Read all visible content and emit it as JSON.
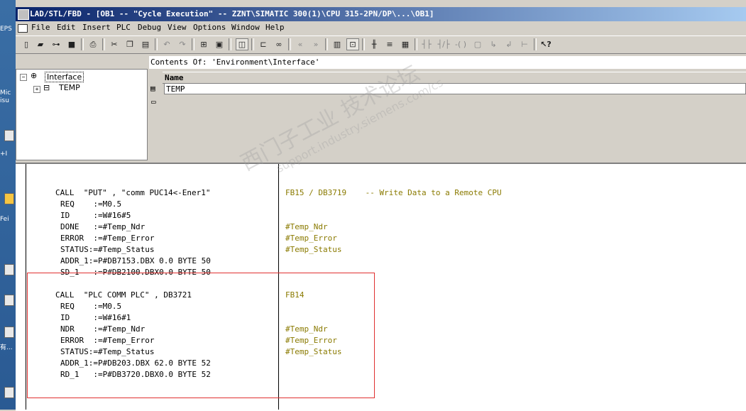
{
  "window": {
    "title": "LAD/STL/FBD  - [OB1 -- \"Cycle Execution\" -- ZZNT\\SIMATIC 300(1)\\CPU 315-2PN/DP\\...\\OB1]"
  },
  "desktop": {
    "labels": [
      "EPS",
      "Mic",
      "isu",
      "+I",
      "Fei",
      "有..."
    ]
  },
  "menu": {
    "items": [
      "File",
      "Edit",
      "Insert",
      "PLC",
      "Debug",
      "View",
      "Options",
      "Window",
      "Help"
    ]
  },
  "toolbar": {
    "icons": [
      "new-icon",
      "open-icon",
      "network-icon",
      "save-icon",
      "print-icon",
      "cut-icon",
      "copy-icon",
      "paste-icon",
      "undo-icon",
      "redo-icon",
      "monitor-icon",
      "download-icon",
      "overview-icon",
      "network-view-icon",
      "glasses-icon",
      "back-icon",
      "forward-icon",
      "panel-icon",
      "zoom-icon",
      "ladder-icon",
      "stl-icon",
      "fbd-icon",
      "contact-no-icon",
      "contact-nc-icon",
      "coil-icon",
      "box-icon",
      "branch-open-icon",
      "branch-close-icon",
      "jump-icon",
      "help-icon"
    ]
  },
  "interface_tree": {
    "root": "Interface",
    "child": "TEMP"
  },
  "contents": {
    "header": "Contents Of: 'Environment\\Interface'",
    "column_name": "Name",
    "rows": [
      "TEMP"
    ]
  },
  "code": {
    "block1": {
      "call": "CALL  \"PUT\" , \"comm PUC14<-Ener1\"",
      "params": [
        "REQ    :=M0.5",
        "ID     :=W#16#5",
        "DONE   :=#Temp_Ndr",
        "ERROR  :=#Temp_Error",
        "STATUS:=#Temp_Status",
        "ADDR_1:=P#DB7153.DBX 0.0 BYTE 50",
        "SD_1   :=P#DB2100.DBX0.0 BYTE 50"
      ],
      "comment_call": "FB15 / DB3719    -- Write Data to a Remote CPU",
      "comments": [
        "",
        "",
        "#Temp_Ndr",
        "#Temp_Error",
        "#Temp_Status",
        "",
        ""
      ]
    },
    "block2": {
      "call": "CALL  \"PLC COMM PLC\" , DB3721",
      "params": [
        "REQ    :=M0.5",
        "ID     :=W#16#1",
        "NDR    :=#Temp_Ndr",
        "ERROR  :=#Temp_Error",
        "STATUS:=#Temp_Status",
        "ADDR_1:=P#DB203.DBX 62.0 BYTE 52",
        "RD_1   :=P#DB3720.DBX0.0 BYTE 52"
      ],
      "comment_call": "FB14",
      "comments": [
        "",
        "",
        "#Temp_Ndr",
        "#Temp_Error",
        "#Temp_Status",
        "",
        ""
      ]
    }
  },
  "watermark": {
    "line1": "西门子工业 技术论坛",
    "line2": "support.industry.siemens.com/cs"
  },
  "colors": {
    "title_start": "#0a246a",
    "title_end": "#a6caf0",
    "comment": "#8a7a00",
    "highlight_box": "#e03030"
  }
}
